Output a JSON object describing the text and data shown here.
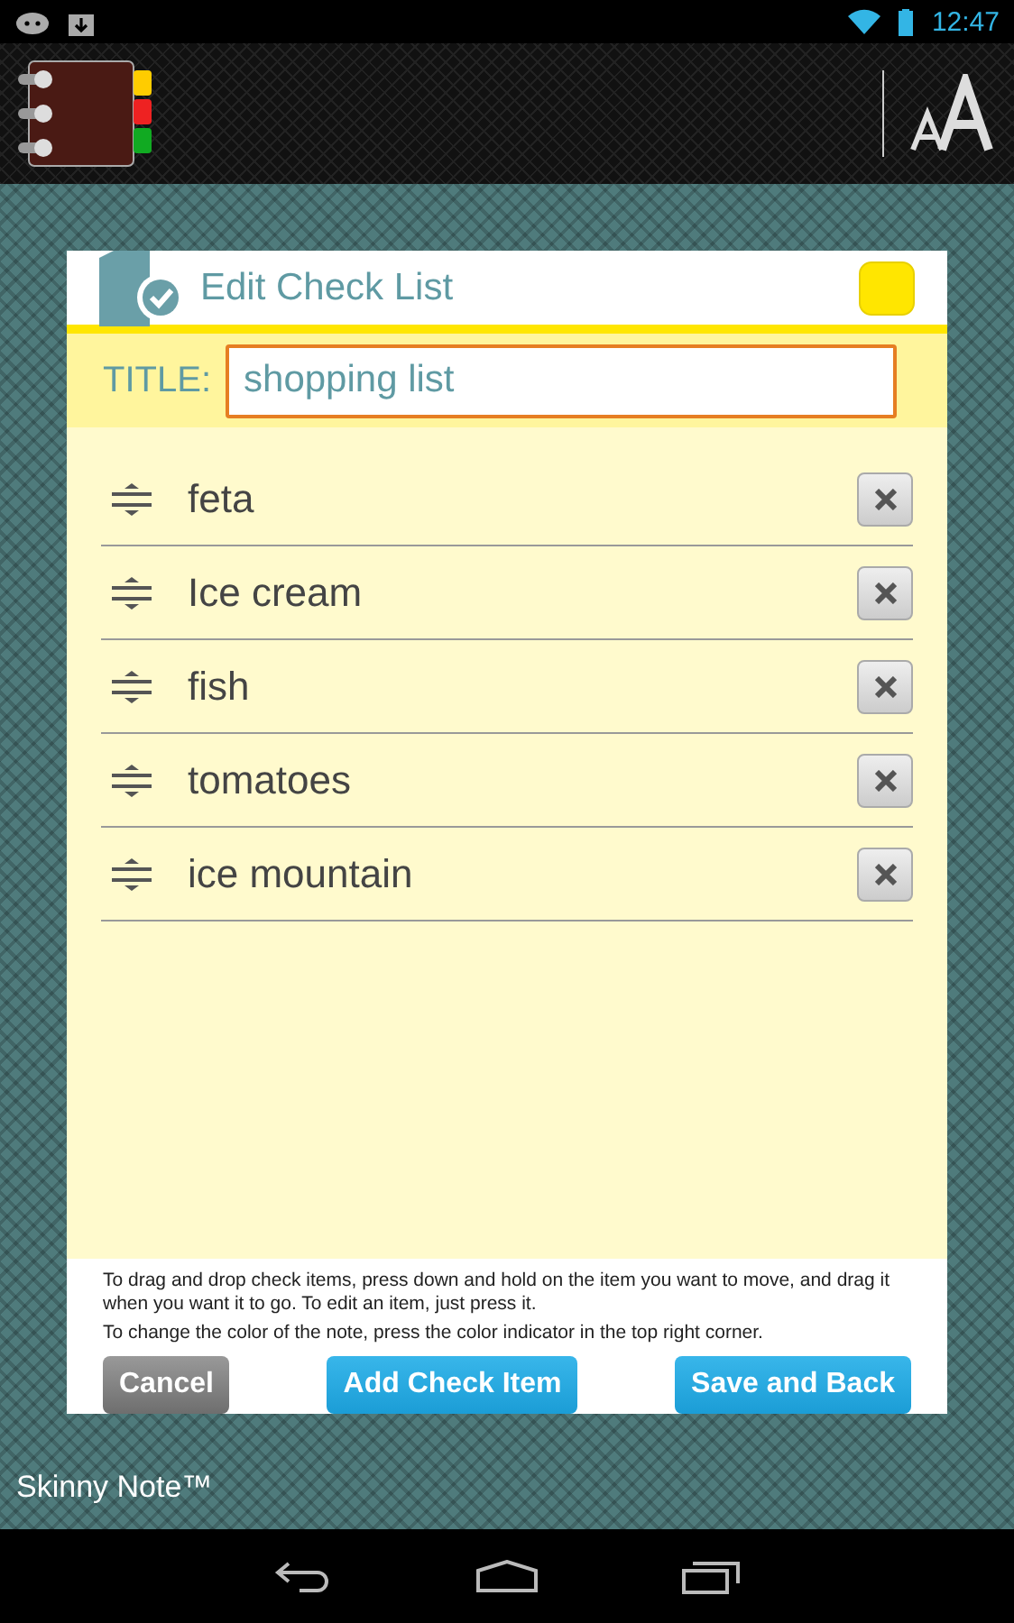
{
  "status_bar": {
    "time": "12:47"
  },
  "dialog": {
    "title": "Edit Check List",
    "color_indicator": {
      "color": "#ffe600"
    },
    "title_label": "TITLE:",
    "title_value": "shopping list",
    "items": [
      {
        "text": "feta"
      },
      {
        "text": "Ice cream"
      },
      {
        "text": "fish"
      },
      {
        "text": "tomatoes"
      },
      {
        "text": "ice mountain"
      }
    ],
    "help": [
      "To drag and drop check items, press down and hold on the item you want to move, and drag it when you want it to go. To edit an item, just press it.",
      "To change the color of the note, press the color indicator in the top right corner."
    ],
    "buttons": [
      {
        "label": "Cancel",
        "kind": "secondary"
      },
      {
        "label": "Add Check Item",
        "kind": "primary"
      },
      {
        "label": "Save and Back",
        "kind": "primary"
      }
    ]
  },
  "footer": {
    "app_name": "Skinny Note™"
  }
}
